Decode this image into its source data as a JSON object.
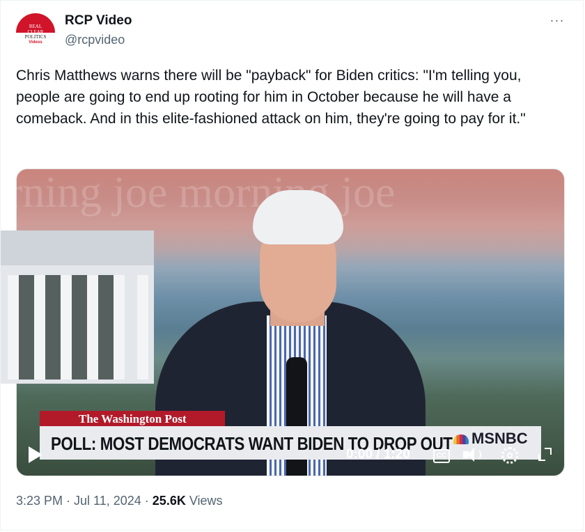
{
  "author": {
    "name": "RCP Video",
    "handle": "@rcpvideo",
    "avatar_text": {
      "line1": "REAL",
      "line2": "CLEAR",
      "line3": "POLITICS",
      "line4": "Videos"
    }
  },
  "tweet": {
    "text": "Chris Matthews warns there will be \"payback\" for Biden critics: \"I'm telling you, people are going to end up rooting for him in October because he will have a comeback. And in this elite-fashioned attack on him, they're going to pay for it.\""
  },
  "video": {
    "background_text": "rning joe   morning joe",
    "wapo_label": "The Washington Post",
    "headline": "POLL: MOST DEMOCRATS WANT BIDEN TO DROP OUT",
    "network": "MSNBC",
    "time_display": "0:00 / 1:20",
    "cc_label": "CC"
  },
  "meta": {
    "time": "3:23 PM",
    "sep1": " · ",
    "date": "Jul 11, 2024",
    "sep2": " · ",
    "views_count": "25.6K",
    "views_label": " Views"
  },
  "more_label": "···",
  "colors": {
    "primary_text": "#0f1419",
    "secondary_text": "#536471",
    "wapo_red": "#b21a2a",
    "avatar_red": "#d0142a"
  }
}
